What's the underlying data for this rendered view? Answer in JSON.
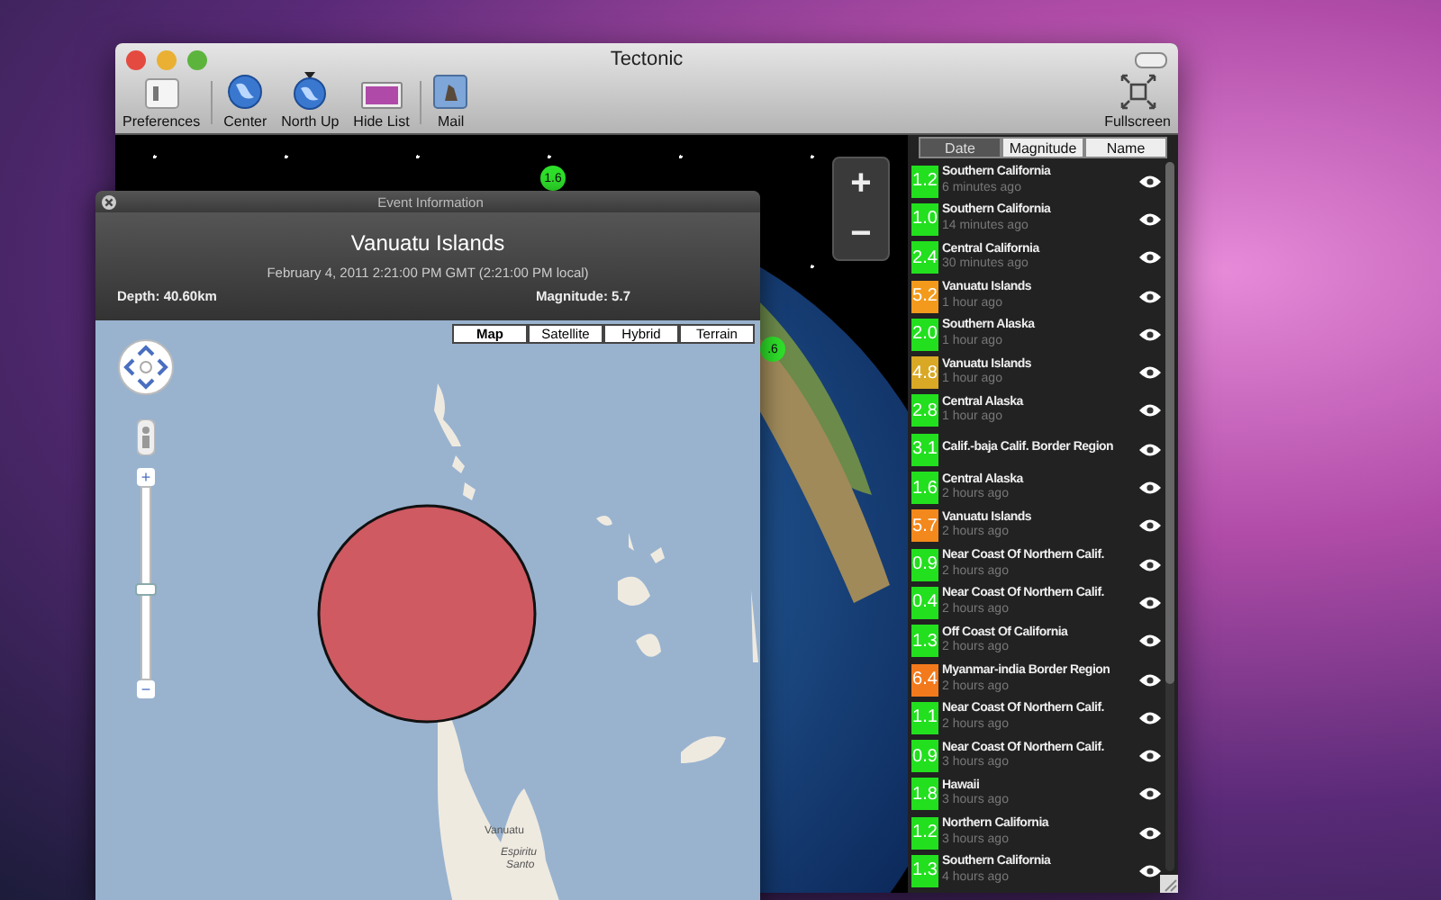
{
  "window": {
    "title": "Tectonic"
  },
  "toolbar": [
    {
      "label": "Preferences",
      "kind": "prefs"
    },
    {
      "label": "Center",
      "kind": "globe"
    },
    {
      "label": "North Up",
      "kind": "north"
    },
    {
      "label": "Hide List",
      "kind": "screen"
    },
    {
      "label": "Mail",
      "kind": "mail"
    }
  ],
  "fullscreen": {
    "label": "Fullscreen"
  },
  "globe": {
    "markers": [
      {
        "label": "1.6"
      },
      {
        "label": ".6"
      }
    ],
    "zoom_in": "+",
    "zoom_out": "−"
  },
  "sort_tabs": [
    {
      "label": "Date",
      "selected": true
    },
    {
      "label": "Magnitude",
      "selected": false
    },
    {
      "label": "Name",
      "selected": false
    }
  ],
  "quakes": [
    {
      "magnitude": "1.2",
      "place": "Southern California",
      "time": "6 minutes ago",
      "color": "#22e01e"
    },
    {
      "magnitude": "1.0",
      "place": "Southern California",
      "time": "14 minutes ago",
      "color": "#22e01e"
    },
    {
      "magnitude": "2.4",
      "place": "Central California",
      "time": "30 minutes ago",
      "color": "#22e01e"
    },
    {
      "magnitude": "5.2",
      "place": "Vanuatu Islands",
      "time": "1 hour ago",
      "color": "#f39a1c"
    },
    {
      "magnitude": "2.0",
      "place": "Southern Alaska",
      "time": "1 hour ago",
      "color": "#22e01e"
    },
    {
      "magnitude": "4.8",
      "place": "Vanuatu Islands",
      "time": "1 hour ago",
      "color": "#d9a825"
    },
    {
      "magnitude": "2.8",
      "place": "Central Alaska",
      "time": "1 hour ago",
      "color": "#22e01e"
    },
    {
      "magnitude": "3.1",
      "place": "Calif.-baja Calif. Border Region",
      "color": "#22e01e"
    },
    {
      "magnitude": "1.6",
      "place": "Central Alaska",
      "time": "2 hours ago",
      "color": "#22e01e"
    },
    {
      "magnitude": "5.7",
      "place": "Vanuatu Islands",
      "time": "2 hours ago",
      "color": "#f3881c"
    },
    {
      "magnitude": "0.9",
      "place": "Near Coast Of Northern Calif.",
      "time": "2 hours ago",
      "color": "#22e01e"
    },
    {
      "magnitude": "0.4",
      "place": "Near Coast Of Northern Calif.",
      "time": "2 hours ago",
      "color": "#22e01e"
    },
    {
      "magnitude": "1.3",
      "place": "Off Coast Of California",
      "time": "2 hours ago",
      "color": "#22e01e"
    },
    {
      "magnitude": "6.4",
      "place": "Myanmar-india Border Region",
      "time": "2 hours ago",
      "color": "#f37a1c"
    },
    {
      "magnitude": "1.1",
      "place": "Near Coast Of Northern Calif.",
      "time": "2 hours ago",
      "color": "#22e01e"
    },
    {
      "magnitude": "0.9",
      "place": "Near Coast Of Northern Calif.",
      "time": "3 hours ago",
      "color": "#22e01e"
    },
    {
      "magnitude": "1.8",
      "place": "Hawaii",
      "time": "3 hours ago",
      "color": "#22e01e"
    },
    {
      "magnitude": "1.2",
      "place": "Northern California",
      "time": "3 hours ago",
      "color": "#22e01e"
    },
    {
      "magnitude": "1.3",
      "place": "Southern California",
      "time": "4 hours ago",
      "color": "#22e01e"
    }
  ],
  "event_panel": {
    "title": "Event Information",
    "place": "Vanuatu Islands",
    "date": "February 4, 2011 2:21:00 PM GMT (2:21:00 PM local)",
    "depth": "Depth: 40.60km",
    "magnitude": "Magnitude: 5.7",
    "map_types": [
      {
        "label": "Map",
        "selected": true
      },
      {
        "label": "Satellite",
        "selected": false
      },
      {
        "label": "Hybrid",
        "selected": false
      },
      {
        "label": "Terrain",
        "selected": false
      }
    ],
    "zoom_slider": {
      "level": 0.43,
      "plus": "+",
      "minus": "−"
    },
    "map_labels": [
      {
        "text": "Vanuatu",
        "kind": "country"
      },
      {
        "text": "Espiritu",
        "kind": "island"
      },
      {
        "text": "Santo",
        "kind": "island"
      }
    ]
  }
}
